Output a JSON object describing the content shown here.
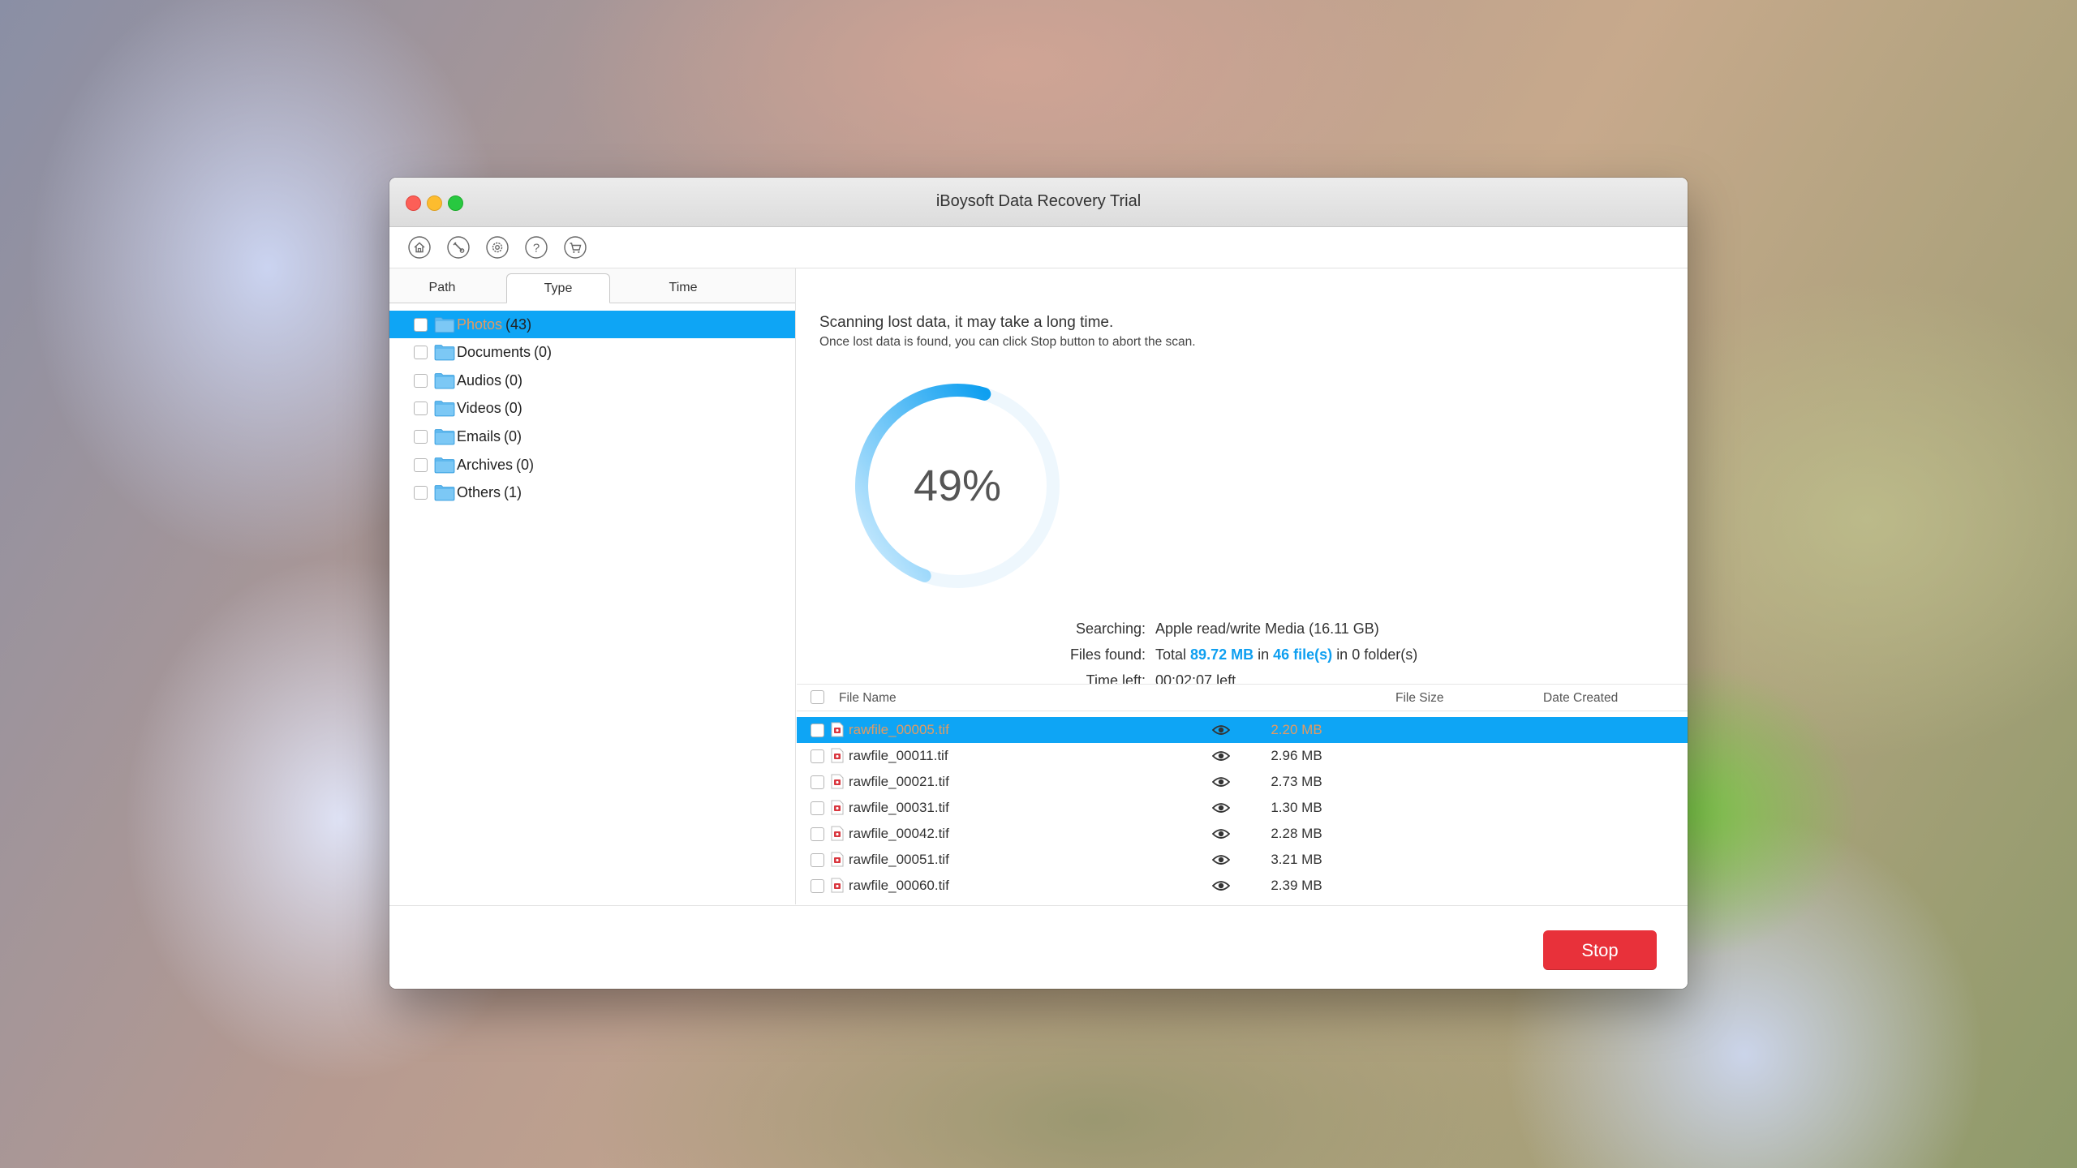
{
  "window": {
    "title": "iBoysoft Data Recovery Trial"
  },
  "toolbar": {
    "icons": [
      "home-icon",
      "tools-icon",
      "settings-icon",
      "help-icon",
      "cart-icon"
    ]
  },
  "tabs": [
    "Path",
    "Type",
    "Time"
  ],
  "active_tab": "Type",
  "tree": [
    {
      "name": "Photos",
      "count": "(43)",
      "selected": true
    },
    {
      "name": "Documents",
      "count": "(0)",
      "selected": false
    },
    {
      "name": "Audios",
      "count": "(0)",
      "selected": false
    },
    {
      "name": "Videos",
      "count": "(0)",
      "selected": false
    },
    {
      "name": "Emails",
      "count": "(0)",
      "selected": false
    },
    {
      "name": "Archives",
      "count": "(0)",
      "selected": false
    },
    {
      "name": "Others",
      "count": "(1)",
      "selected": false
    }
  ],
  "scan": {
    "title": "Scanning lost data, it may take a long time.",
    "subtitle": "Once lost data is found, you can click Stop button to abort the scan.",
    "progress_label": "49%",
    "progress": 0.49,
    "searching_label": "Searching:",
    "searching_value": "Apple read/write Media (16.11 GB)",
    "found_label": "Files found:",
    "found_prefix": "Total",
    "found_size": "89.72 MB",
    "found_in": "in",
    "found_count": "46 file(s)",
    "found_suffix": "in 0 folder(s)",
    "time_label": "Time left:",
    "time_value": "00:02:07 left"
  },
  "filelist": {
    "headers": {
      "name": "File Name",
      "size": "File Size",
      "date": "Date Created"
    },
    "rows": [
      {
        "name": "rawfile_00005.tif",
        "size": "2.20 MB",
        "selected": true
      },
      {
        "name": "rawfile_00011.tif",
        "size": "2.96 MB",
        "selected": false
      },
      {
        "name": "rawfile_00021.tif",
        "size": "2.73 MB",
        "selected": false
      },
      {
        "name": "rawfile_00031.tif",
        "size": "1.30 MB",
        "selected": false
      },
      {
        "name": "rawfile_00042.tif",
        "size": "2.28 MB",
        "selected": false
      },
      {
        "name": "rawfile_00051.tif",
        "size": "3.21 MB",
        "selected": false
      },
      {
        "name": "rawfile_00060.tif",
        "size": "2.39 MB",
        "selected": false
      }
    ]
  },
  "footer": {
    "stop_label": "Stop"
  },
  "colors": {
    "accent": "#0ea5f5",
    "stop": "#e8313a",
    "ring_start": "#d6efff",
    "ring_end": "#0e9ff0"
  }
}
